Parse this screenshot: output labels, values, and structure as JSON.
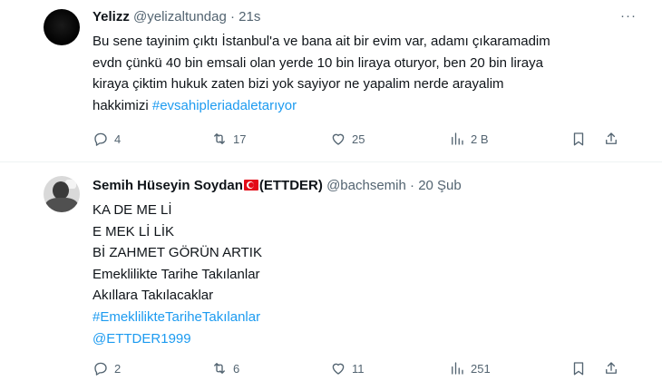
{
  "tweets": [
    {
      "author_name": "Yelizz",
      "handle": "@yelizaltundag",
      "separator": "·",
      "time": "21s",
      "more": "···",
      "text_plain": "Bu sene tayinim çıktı İstanbul'a ve bana ait bir evim var, adamı çıkaramadim\nevdn çünkü 40 bin emsali olan yerde 10 bin liraya oturyor, ben 20 bin liraya\nkiraya çiktim hukuk zaten bizi yok sayiyor ne yapalim nerde arayalim\nhakkimizi ",
      "hashtag": "#evsahipleriadaletarıyor",
      "replies": "4",
      "retweets": "17",
      "likes": "25",
      "views": "2 B"
    },
    {
      "author_name": "Semih Hüseyin Soydan",
      "author_suffix": "(ETTDER)",
      "handle": "@bachsemih",
      "separator": "·",
      "time": "20 Şub",
      "lines": [
        "KA DE ME Lİ",
        "E MEK Lİ LİK",
        "Bİ ZAHMET GÖRÜN ARTIK",
        "Emeklilikte Tarihe Takılanlar",
        "Akıllara Takılacaklar"
      ],
      "hashtag": "#EmeklilikteTariheTakılanlar",
      "mention": "@ETTDER1999",
      "replies": "2",
      "retweets": "6",
      "likes": "11",
      "views": "251"
    }
  ],
  "icons": {
    "reply": "reply-icon",
    "retweet": "retweet-icon",
    "like": "heart-icon",
    "views": "views-icon",
    "bookmark": "bookmark-icon",
    "share": "share-icon",
    "flag": "turkey-flag-icon"
  },
  "colors": {
    "text": "#0f1419",
    "secondary": "#536471",
    "link": "#1d9bf0",
    "separator": "#eff3f4"
  }
}
